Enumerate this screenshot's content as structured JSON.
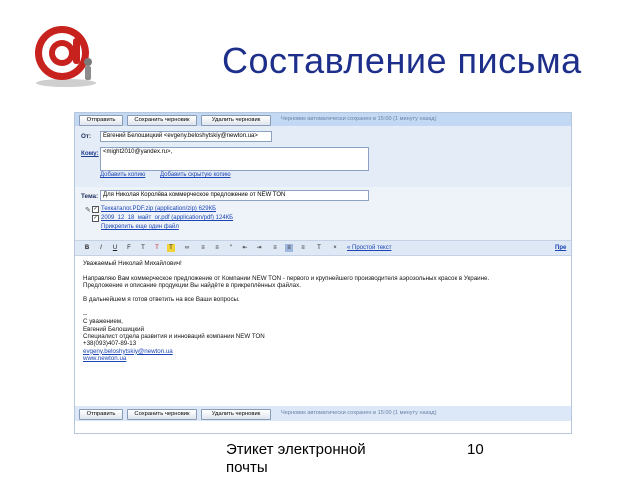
{
  "slide": {
    "title": "Составление письма",
    "footer_line1": "Этикет электронной",
    "footer_line2": "почты",
    "page_number": "10"
  },
  "toolbar": {
    "send_label": "Отправить",
    "save_draft_label": "Сохранить черновик",
    "delete_draft_label": "Удалить черновик",
    "autosave_status": "Черновик автоматически сохранен в 15:00 (1 минуту назад)"
  },
  "headers": {
    "from_label": "От:",
    "from_value": "Евгений Белошицкий <evgeny.beloshytskiy@newton.ua>",
    "to_label": "Кому:",
    "to_value": "<might2010@yandex.ru>,",
    "add_copy": "Добавить копию",
    "add_bcc": "Добавить скрытую копию",
    "subject_label": "Тема:",
    "subject_value": "Для Николая Королёва коммерческое предложение от NEW TON"
  },
  "attachments": [
    "Техкаталог.PDF.zip (application/zip) 629КБ",
    "2009_12_18_майт_or.pdf (application/pdf) 124КБ"
  ],
  "attach_more": "Прикрепить еще один файл",
  "format_bar": {
    "plain_text_link": "« Простой текст",
    "right_link": "Пре"
  },
  "body": {
    "greeting": "Уважаемый Николай Михайлович!",
    "line1": "Направляю Вам коммерческое предложение от Компании NEW TON - первого и крупнейшего производителя аэрозольных красок в Украине.",
    "line2": "Предложение и описание продукции Вы найдёте в прикреплённых файлах.",
    "line3": "В дальнейшем я готов ответить на все Ваши вопросы.",
    "sig_sep": "--",
    "sig_regards": "С уважением,",
    "sig_name": "Евгений Белошицкий",
    "sig_title": "Специалист отдела развития и инноваций компании NEW TON",
    "sig_phone": "+38(093)407-89-13",
    "sig_email": "evgeny.beloshytskiy@newton.ua",
    "sig_site": "www.newton.ua"
  },
  "colors": {
    "title": "#1d2f8a",
    "logo": "#c8221e",
    "toolbar": "#c3d9f3",
    "link": "#1b45b5"
  }
}
